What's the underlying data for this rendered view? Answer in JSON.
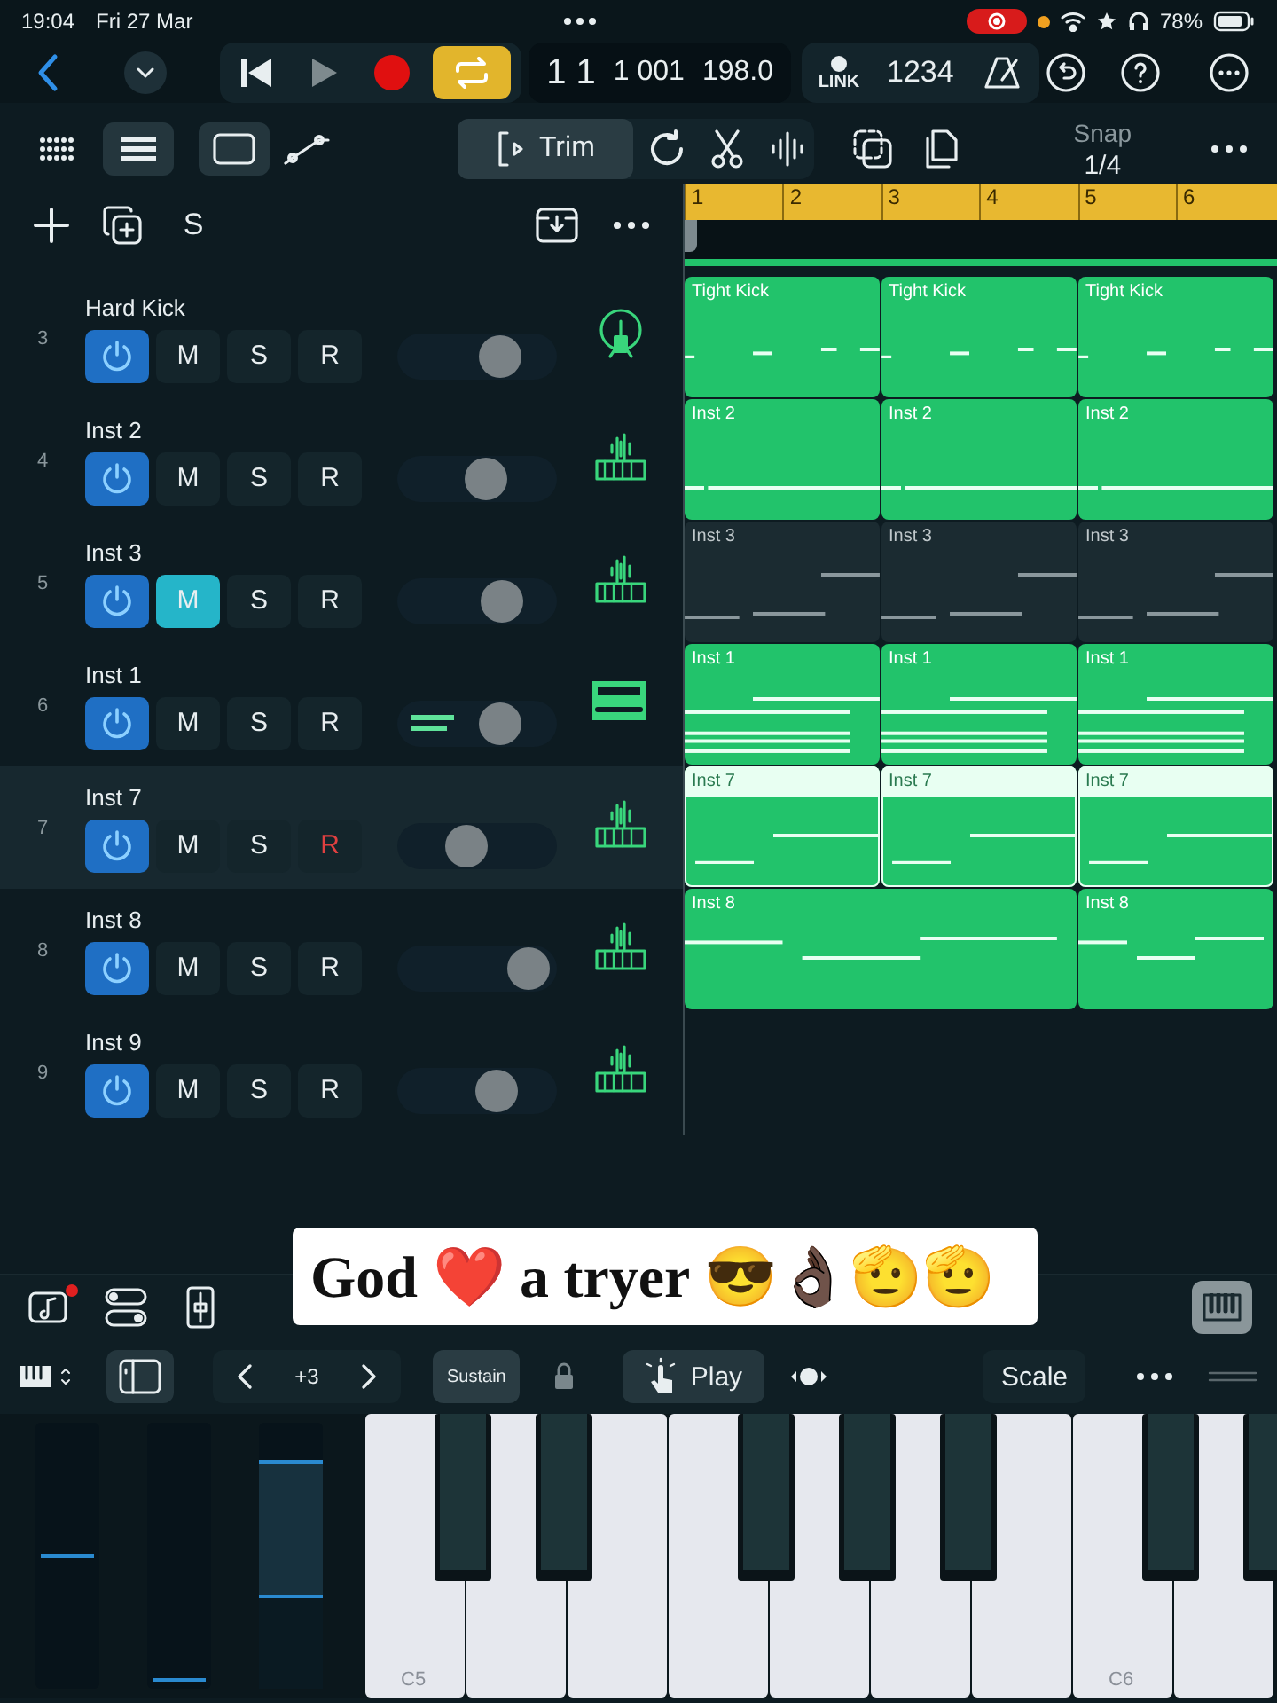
{
  "status_bar": {
    "time": "19:04",
    "date": "Fri 27 Mar",
    "battery": "78%"
  },
  "transport": {
    "loop_on": true,
    "record_armed": true,
    "lcd": {
      "position": "1 1",
      "ticks": "1 001",
      "tempo": "198.0"
    },
    "link": "LINK",
    "count_in": "1234"
  },
  "toolbar": {
    "views": [
      {
        "kind": "grid",
        "selected": false
      },
      {
        "kind": "tracks",
        "selected": true
      }
    ],
    "trim": "Trim",
    "snap_label": "Snap",
    "snap_value": "1/4"
  },
  "track_header": {
    "solo_label": "S"
  },
  "ruler": {
    "bars": [
      "1",
      "2",
      "3",
      "4",
      "5",
      "6"
    ]
  },
  "tracks": [
    {
      "number": "3",
      "name": "Hard Kick",
      "power": true,
      "mute_label": "M",
      "mute": false,
      "solo_label": "S",
      "solo": false,
      "record_label": "R",
      "record": false,
      "level": 0.7,
      "signal": false,
      "selected": false,
      "kind": "drum",
      "regions": [
        {
          "label": "Tight Kick",
          "kind": "single",
          "selected": false
        },
        {
          "label": "Tight Kick",
          "kind": "single",
          "selected": false
        },
        {
          "label": "Tight Kick",
          "kind": "single",
          "selected": false
        }
      ]
    },
    {
      "number": "4",
      "name": "Inst 2",
      "power": true,
      "mute_label": "M",
      "mute": false,
      "solo_label": "S",
      "solo": false,
      "record_label": "R",
      "record": false,
      "level": 0.58,
      "signal": false,
      "selected": false,
      "kind": "keys",
      "regions": [
        {
          "label": "Inst 2",
          "kind": "single",
          "selected": false
        },
        {
          "label": "Inst 2",
          "kind": "single",
          "selected": false
        },
        {
          "label": "Inst 2",
          "kind": "single",
          "selected": false
        }
      ]
    },
    {
      "number": "5",
      "name": "Inst 3",
      "power": true,
      "mute_label": "M",
      "mute": true,
      "solo_label": "S",
      "solo": false,
      "record_label": "R",
      "record": false,
      "level": 0.71,
      "signal": false,
      "selected": false,
      "kind": "keys",
      "regions": [
        {
          "label": "Inst 3",
          "kind": "single",
          "selected": false
        },
        {
          "label": "Inst 3",
          "kind": "single",
          "selected": false
        },
        {
          "label": "Inst 3",
          "kind": "single",
          "selected": false
        }
      ]
    },
    {
      "number": "6",
      "name": "Inst 1",
      "power": true,
      "mute_label": "M",
      "mute": false,
      "solo_label": "S",
      "solo": false,
      "record_label": "R",
      "record": false,
      "level": 0.7,
      "signal": true,
      "selected": false,
      "kind": "synth",
      "regions": [
        {
          "label": "Inst 1",
          "kind": "single",
          "selected": false
        },
        {
          "label": "Inst 1",
          "kind": "single",
          "selected": false
        },
        {
          "label": "Inst 1",
          "kind": "single",
          "selected": false
        }
      ]
    },
    {
      "number": "7",
      "name": "Inst 7",
      "power": true,
      "mute_label": "M",
      "mute": false,
      "solo_label": "S",
      "solo": false,
      "record_label": "R",
      "record": true,
      "level": 0.41,
      "signal": false,
      "selected": true,
      "kind": "keys",
      "regions": [
        {
          "label": "Inst 7",
          "kind": "single",
          "selected": true
        },
        {
          "label": "Inst 7",
          "kind": "single",
          "selected": true
        },
        {
          "label": "Inst 7",
          "kind": "single",
          "selected": true
        }
      ]
    },
    {
      "number": "8",
      "name": "Inst 8",
      "power": true,
      "mute_label": "M",
      "mute": false,
      "solo_label": "S",
      "solo": false,
      "record_label": "R",
      "record": false,
      "level": 0.94,
      "signal": false,
      "selected": false,
      "kind": "keys",
      "regions": [
        {
          "label": "Inst 8",
          "kind": "double",
          "selected": false
        },
        {
          "label": "Inst 8",
          "kind": "single",
          "selected": false
        }
      ]
    },
    {
      "number": "9",
      "name": "Inst 9",
      "power": true,
      "mute_label": "M",
      "mute": false,
      "solo_label": "S",
      "solo": false,
      "record_label": "R",
      "record": false,
      "level": 0.67,
      "signal": false,
      "selected": false,
      "kind": "keys"
    }
  ],
  "caption": "God ❤️ a tryer 😎👌🏿🫡🫡",
  "bottom_bar": {
    "library_badge": true,
    "keyboard_selected": true
  },
  "keyboard_controls": {
    "octave": "+3",
    "sustain": "Sustain",
    "play": "Play",
    "scale": "Scale"
  },
  "wheels": [
    {
      "kind": "line",
      "level": 0.5
    },
    {
      "kind": "line",
      "level": 0.03
    },
    {
      "kind": "band",
      "level": 0.86
    }
  ],
  "keyboard": {
    "octave_labels": [
      "C5",
      "C6"
    ]
  }
}
